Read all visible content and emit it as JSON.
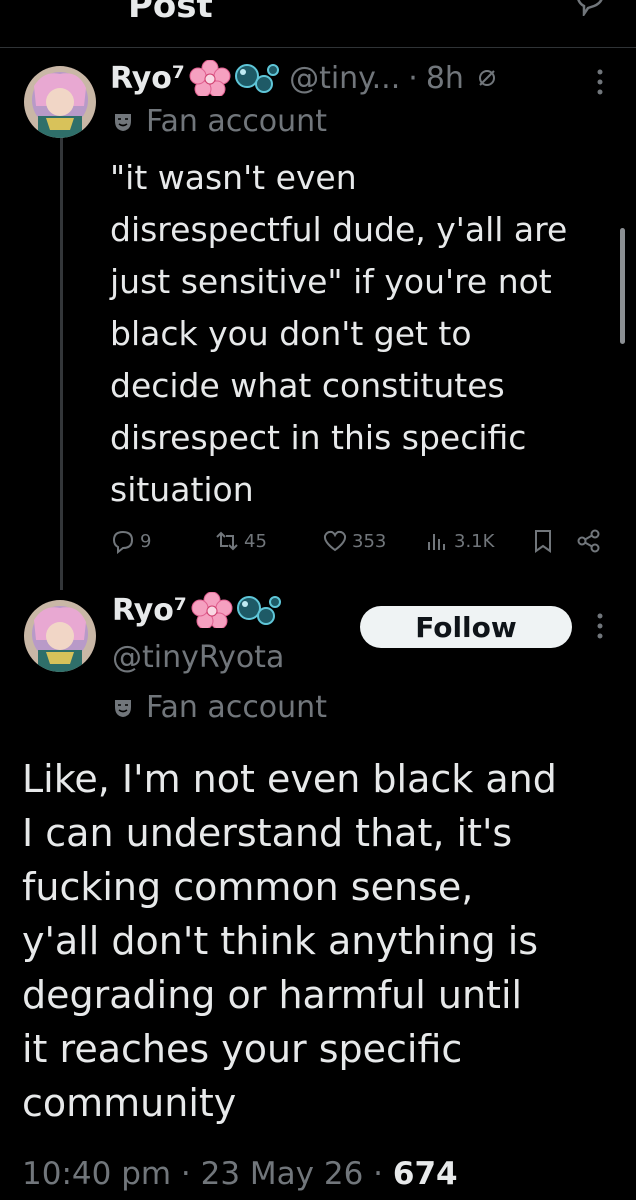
{
  "header": {
    "title": "Post"
  },
  "reply": {
    "display_name": "Ryo⁷",
    "handle": "@tiny...",
    "dot": "·",
    "time": "8h",
    "label": "Fan account",
    "text": "\"it wasn't even\ndisrespectful dude, y'all are\njust sensitive\" if you're not\nblack you don't get to\ndecide what constitutes\ndisrespect in this specific\nsituation",
    "replies": "9",
    "reposts": "45",
    "likes": "353",
    "views": "3.1K"
  },
  "main": {
    "display_name": "Ryo⁷",
    "handle": "@tinyRyota",
    "label": "Fan account",
    "follow_label": "Follow",
    "text": "Like, I'm not even black and\nI can understand that, it's\nfucking common sense,\ny'all don't think anything is\ndegrading or harmful until\nit reaches your specific\ncommunity",
    "timestamp": "10:40 pm · 23 May 26 · ",
    "views_count": "674"
  },
  "icons": {
    "back": "arrow-left-icon",
    "reply_header": "reply-icon",
    "muted": "muted-icon",
    "more": "more-vertical-icon",
    "label": "theater-mask-icon",
    "reply": "comment-icon",
    "repost": "repost-icon",
    "like": "heart-icon",
    "views": "views-icon",
    "bookmark": "bookmark-icon",
    "share": "share-icon",
    "flower": "cherry-blossom-emoji",
    "bubbles": "bubbles-emoji"
  },
  "colors": {
    "background": "#000000",
    "text": "#e7e9ea",
    "secondary": "#71767b",
    "divider": "#2f3336",
    "follow_bg": "#eff3f4"
  }
}
